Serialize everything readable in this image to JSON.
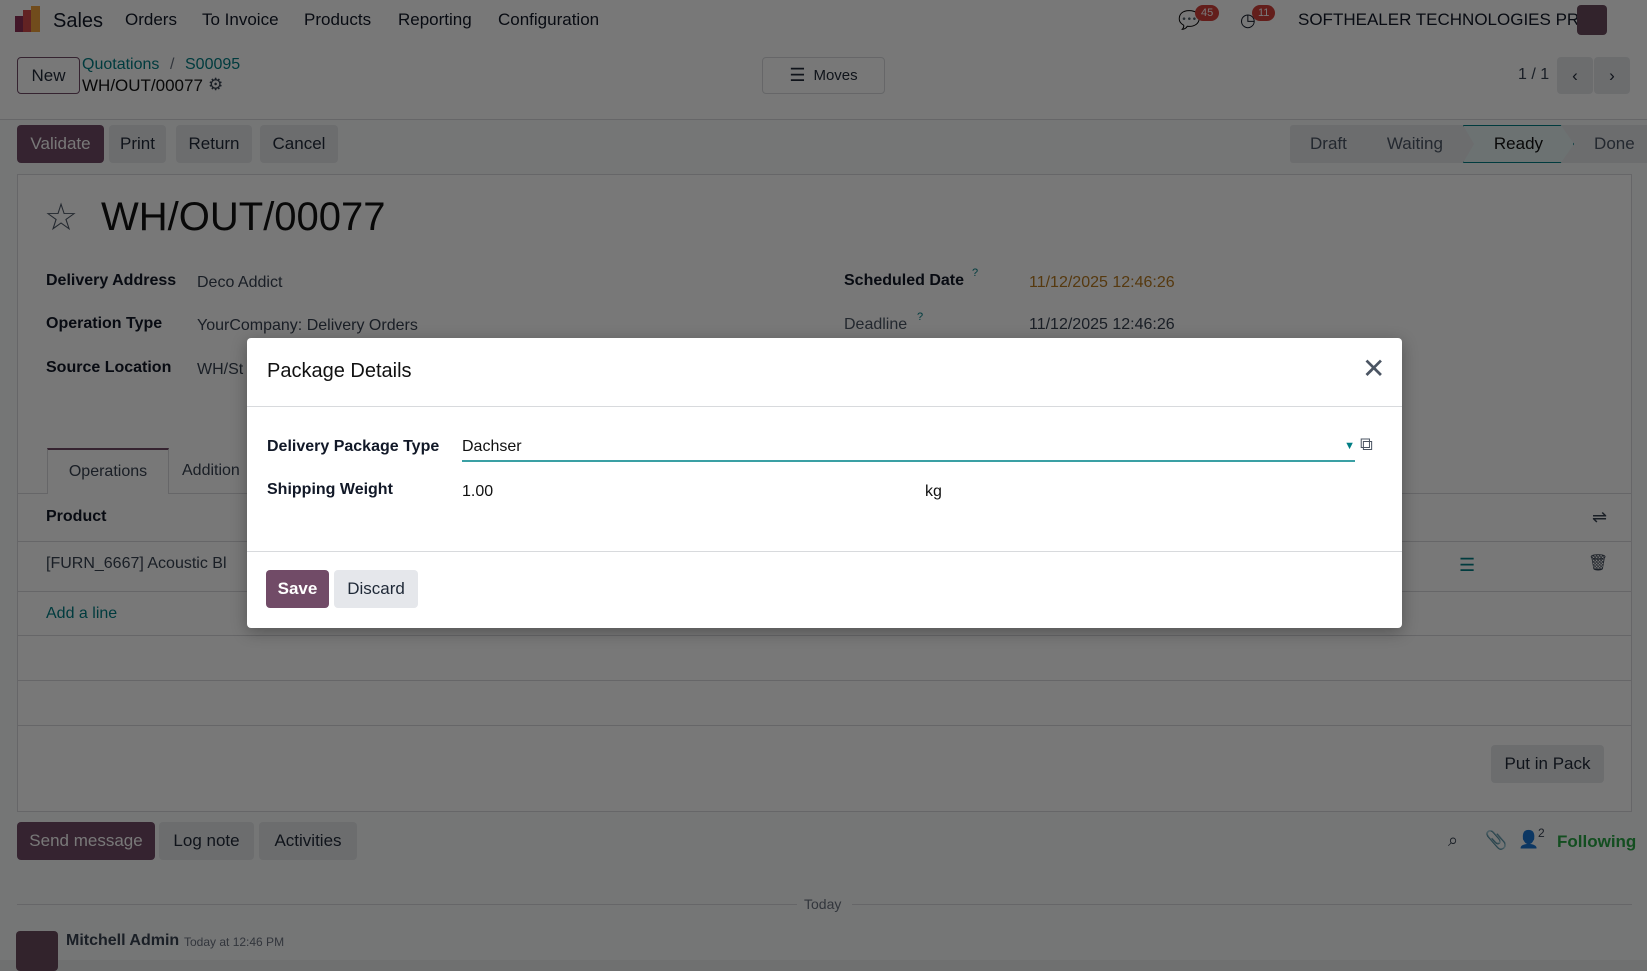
{
  "navbar": {
    "app": "Sales",
    "menu": [
      "Orders",
      "To Invoice",
      "Products",
      "Reporting",
      "Configuration"
    ],
    "messages_count": "45",
    "activities_count": "11",
    "company": "SOFTHEALER TECHNOLOGIES PRI..."
  },
  "control_panel": {
    "new_label": "New",
    "breadcrumb": [
      "Quotations",
      "S00095"
    ],
    "current": "WH/OUT/00077",
    "moves_label": "Moves",
    "pager": "1 / 1"
  },
  "actions": {
    "validate": "Validate",
    "print": "Print",
    "return": "Return",
    "cancel": "Cancel"
  },
  "statusbar": {
    "stages": [
      "Draft",
      "Waiting",
      "Ready",
      "Done"
    ],
    "current": "Ready"
  },
  "form": {
    "title": "WH/OUT/00077",
    "fields": {
      "delivery_address_label": "Delivery Address",
      "delivery_address": "Deco Addict",
      "operation_type_label": "Operation Type",
      "operation_type": "YourCompany: Delivery Orders",
      "source_location_label": "Source Location",
      "source_location": "WH/St",
      "scheduled_date_label": "Scheduled Date",
      "scheduled_date": "11/12/2025 12:46:26",
      "deadline_label": "Deadline",
      "deadline": "11/12/2025 12:46:26",
      "help_mark": "?"
    },
    "tabs": [
      "Operations",
      "Addition"
    ],
    "table": {
      "header": "Product",
      "rows": [
        "[FURN_6667] Acoustic Bl"
      ],
      "add_line": "Add a line"
    },
    "put_in_pack": "Put in Pack"
  },
  "chatter": {
    "send_message": "Send message",
    "log_note": "Log note",
    "activities": "Activities",
    "followers_count": "2",
    "following": "Following",
    "today": "Today",
    "author": "Mitchell Admin",
    "time": "Today at 12:46 PM"
  },
  "modal": {
    "title": "Package Details",
    "package_type_label": "Delivery Package Type",
    "package_type": "Dachser",
    "weight_label": "Shipping Weight",
    "weight": "1.00",
    "weight_unit": "kg",
    "save": "Save",
    "discard": "Discard"
  },
  "colors": {
    "primary": "#714b67",
    "link": "#017e84",
    "warning": "#b7791f",
    "following": "#28a745"
  }
}
